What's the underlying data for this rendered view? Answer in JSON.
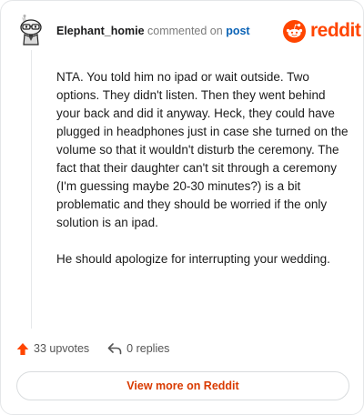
{
  "header": {
    "author": "Elephant_homie",
    "action_text": "commented on",
    "link_text": "post"
  },
  "brand": {
    "name": "reddit",
    "icon": "reddit-alien-icon",
    "color": "#ff4500"
  },
  "comment": {
    "paragraphs": [
      "NTA. You told him no ipad or wait outside. Two options. They didn't listen. Then they went behind your back and did it anyway. Heck, they could have plugged in headphones just in case she turned on the volume so that it wouldn't disturb the ceremony. The fact that their daughter can't sit through a ceremony (I'm guessing maybe 20-30 minutes?) is a bit problematic and they should be worried if the only solution is an ipad.",
      "He should apologize for interrupting your wedding."
    ]
  },
  "actions": {
    "upvotes": "33 upvotes",
    "replies": "0 replies"
  },
  "footer": {
    "button_label": "View more on Reddit"
  },
  "colors": {
    "accent": "#ff4500",
    "link": "#0b63b6",
    "button_text": "#d93a00"
  }
}
